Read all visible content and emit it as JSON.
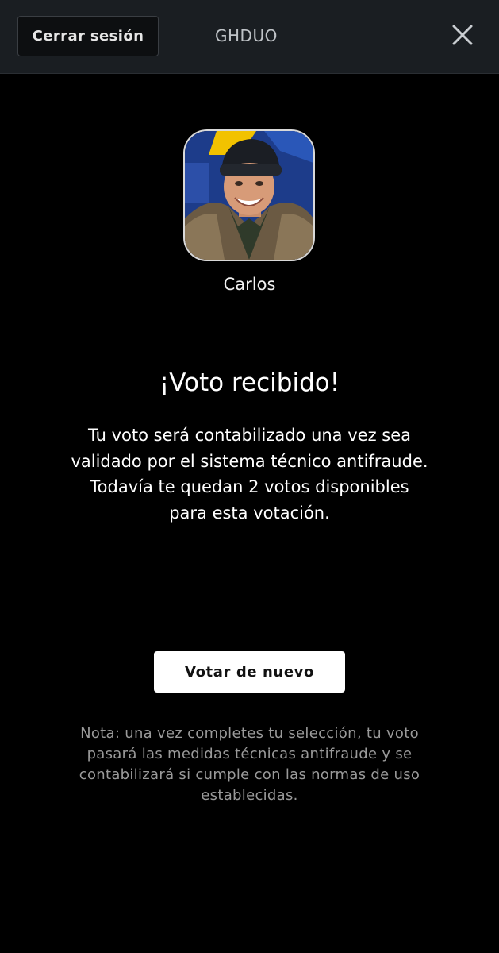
{
  "header": {
    "logout_label": "Cerrar sesión",
    "brand": "GHDUO",
    "close_icon": "close-icon"
  },
  "candidate": {
    "name": "Carlos",
    "photo": "candidate-photo"
  },
  "confirmation": {
    "title": "¡Voto recibido!",
    "message_lines": [
      "Tu voto será contabilizado una vez sea",
      "validado por el sistema técnico antifraude.",
      "Todavía te quedan 2 votos disponibles",
      "para esta votación."
    ]
  },
  "actions": {
    "vote_again_label": "Votar de nuevo"
  },
  "note": {
    "lines": [
      "Nota: una vez completes tu selección, tu voto",
      "pasará las medidas técnicas antifraude y se",
      "contabilizará si cumple con las normas de uso",
      "establecidas."
    ]
  },
  "colors": {
    "background": "#000000",
    "header_bg": "#1a1e22",
    "button_bg": "#ffffff",
    "note_text": "#9a9a9a"
  }
}
